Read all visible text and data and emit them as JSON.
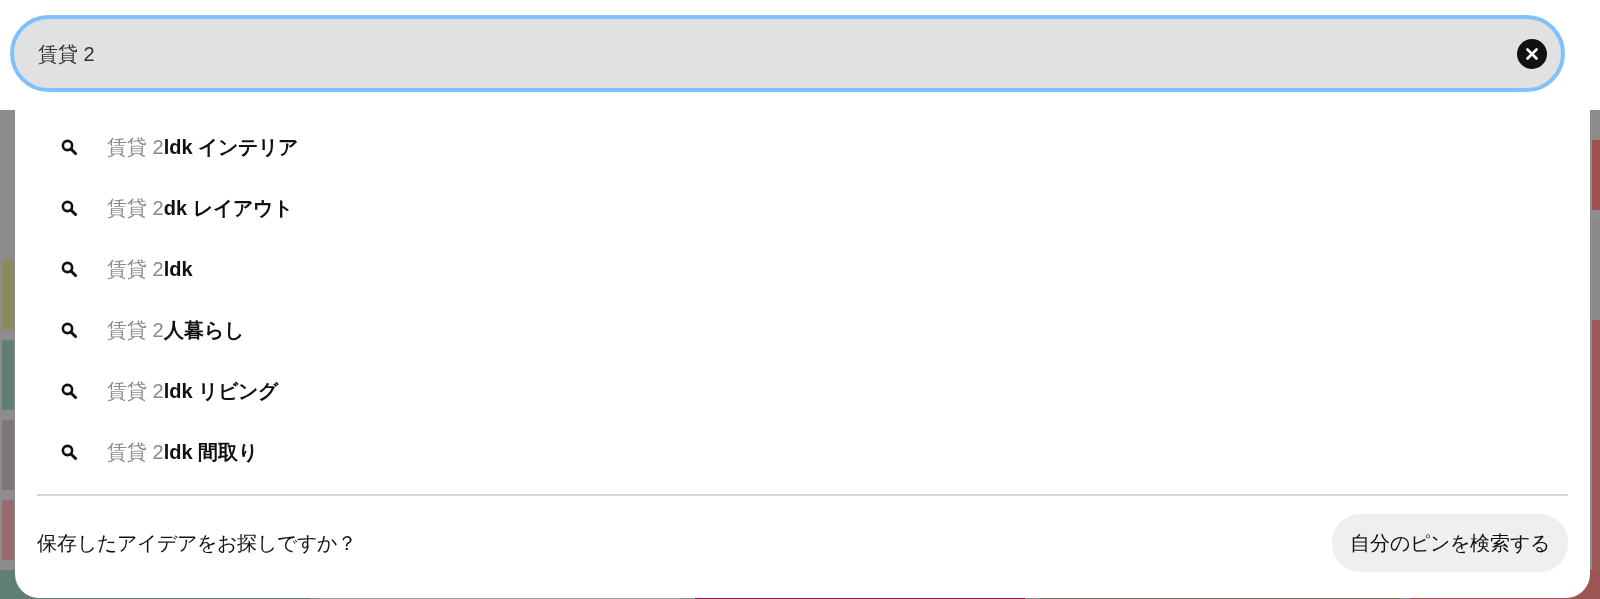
{
  "search": {
    "value": "賃貸 2"
  },
  "suggestions": [
    {
      "typed": "賃貸 2",
      "completion": "ldk インテリア"
    },
    {
      "typed": "賃貸 2",
      "completion": "dk レイアウト"
    },
    {
      "typed": "賃貸 2",
      "completion": "ldk"
    },
    {
      "typed": "賃貸 2",
      "completion": "人暮らし"
    },
    {
      "typed": "賃貸 2",
      "completion": "ldk リビング"
    },
    {
      "typed": "賃貸 2",
      "completion": "ldk 間取り"
    }
  ],
  "footer": {
    "prompt": "保存したアイデアをお探しですか？",
    "button": "自分のピンを検索する"
  }
}
